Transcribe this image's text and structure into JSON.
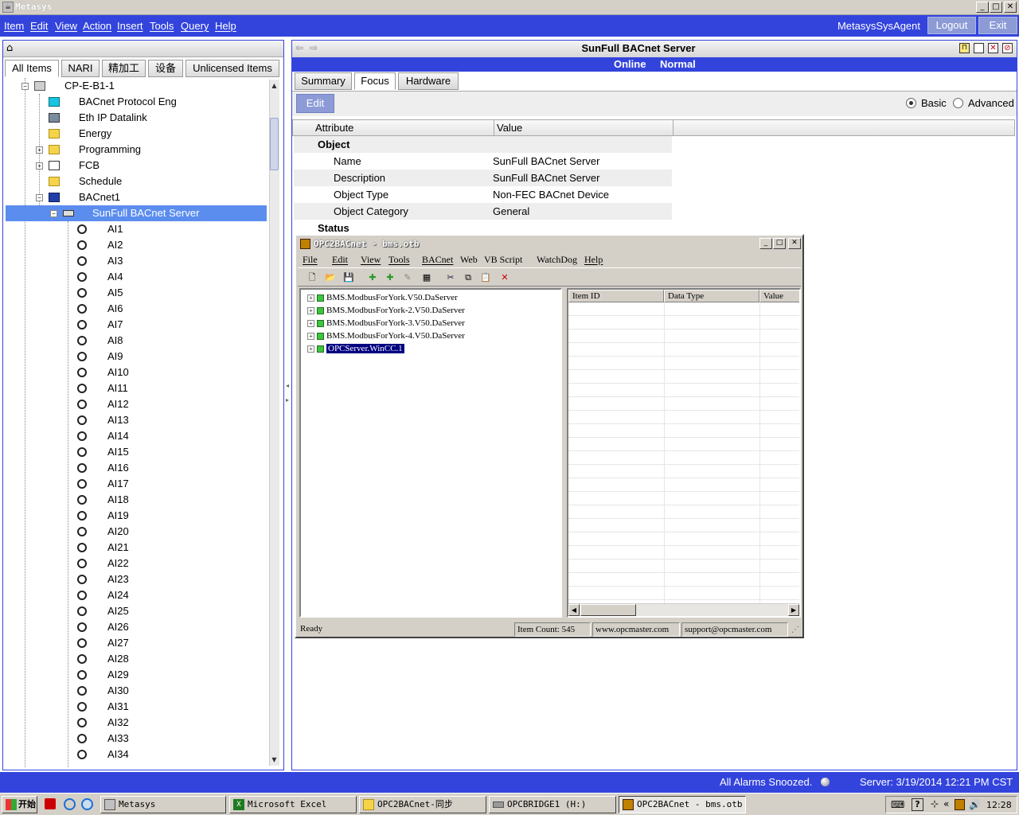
{
  "window": {
    "title": "Metasys",
    "controls": [
      "_",
      "□",
      "✕"
    ]
  },
  "menu": {
    "items": [
      {
        "label": "Item"
      },
      {
        "label": "Edit"
      },
      {
        "label": "View"
      },
      {
        "label": "Action"
      },
      {
        "label": "Insert"
      },
      {
        "label": "Tools"
      },
      {
        "label": "Query"
      },
      {
        "label": "Help"
      }
    ],
    "user": "MetasysSysAgent",
    "logout": "Logout",
    "exit": "Exit"
  },
  "left": {
    "tabs": [
      {
        "label": "All Items"
      },
      {
        "label": "NARI"
      },
      {
        "label": "精加工"
      },
      {
        "label": "设备"
      },
      {
        "label": "Unlicensed Items"
      }
    ],
    "tree": {
      "root": "CP-E-B1-1",
      "children": [
        {
          "label": "BACnet Protocol Eng"
        },
        {
          "label": "Eth IP Datalink"
        },
        {
          "label": "Energy"
        },
        {
          "label": "Programming"
        },
        {
          "label": "FCB"
        },
        {
          "label": "Schedule"
        },
        {
          "label": "BACnet1"
        }
      ],
      "selected": "SunFull BACnet Server",
      "points": [
        "AI1",
        "AI2",
        "AI3",
        "AI4",
        "AI5",
        "AI6",
        "AI7",
        "AI8",
        "AI9",
        "AI10",
        "AI11",
        "AI12",
        "AI13",
        "AI14",
        "AI15",
        "AI16",
        "AI17",
        "AI18",
        "AI19",
        "AI20",
        "AI21",
        "AI22",
        "AI23",
        "AI24",
        "AI25",
        "AI26",
        "AI27",
        "AI28",
        "AI29",
        "AI30",
        "AI31",
        "AI32",
        "AI33",
        "AI34"
      ]
    }
  },
  "right": {
    "title": "SunFull BACnet Server",
    "state": "Online",
    "status": "Normal",
    "tabs": [
      {
        "label": "Summary"
      },
      {
        "label": "Focus"
      },
      {
        "label": "Hardware"
      }
    ],
    "edit": "Edit",
    "view_modes": {
      "basic": "Basic",
      "advanced": "Advanced",
      "selected": "Basic"
    },
    "columns": {
      "attribute": "Attribute",
      "value": "Value"
    },
    "section_object": "Object",
    "rows": [
      {
        "attribute": "Name",
        "value": "SunFull BACnet Server"
      },
      {
        "attribute": "Description",
        "value": "SunFull BACnet Server"
      },
      {
        "attribute": "Object Type",
        "value": "Non-FEC BACnet Device"
      },
      {
        "attribute": "Object Category",
        "value": "General"
      }
    ],
    "section_status": "Status"
  },
  "opc": {
    "title": "OPC2BACnet - bms.otb",
    "menu": [
      {
        "label": "File"
      },
      {
        "label": "Edit"
      },
      {
        "label": "View"
      },
      {
        "label": "Tools"
      },
      {
        "label": "BACnet"
      },
      {
        "label": "Web"
      },
      {
        "label": "VB Script"
      },
      {
        "label": "WatchDog"
      },
      {
        "label": "Help"
      }
    ],
    "servers": [
      "BMS.ModbusForYork.V50.DaServer",
      "BMS.ModbusForYork-2.V50.DaServer",
      "BMS.ModbusForYork-3.V50.DaServer",
      "BMS.ModbusForYork-4.V50.DaServer",
      "OPCServer.WinCC.1"
    ],
    "list_columns": [
      "Item ID",
      "Data Type",
      "Value"
    ],
    "status": {
      "ready": "Ready",
      "item_count": "Item Count: 545",
      "website": "www.opcmaster.com",
      "email": "support@opcmaster.com"
    }
  },
  "statusbar": {
    "alarms": "All Alarms Snoozed.",
    "server": "Server: 3/19/2014 12:21 PM CST"
  },
  "taskbar": {
    "start": "开始",
    "tasks": [
      {
        "label": "Metasys"
      },
      {
        "label": "Microsoft Excel"
      },
      {
        "label": "OPC2BACnet-同步"
      },
      {
        "label": "OPCBRIDGE1 (H:)"
      },
      {
        "label": "OPC2BACnet - bms.otb"
      }
    ],
    "clock": "12:28"
  },
  "colors": {
    "accent": "#3344dd",
    "selection": "#5b8def",
    "opc_selection": "#000080"
  }
}
